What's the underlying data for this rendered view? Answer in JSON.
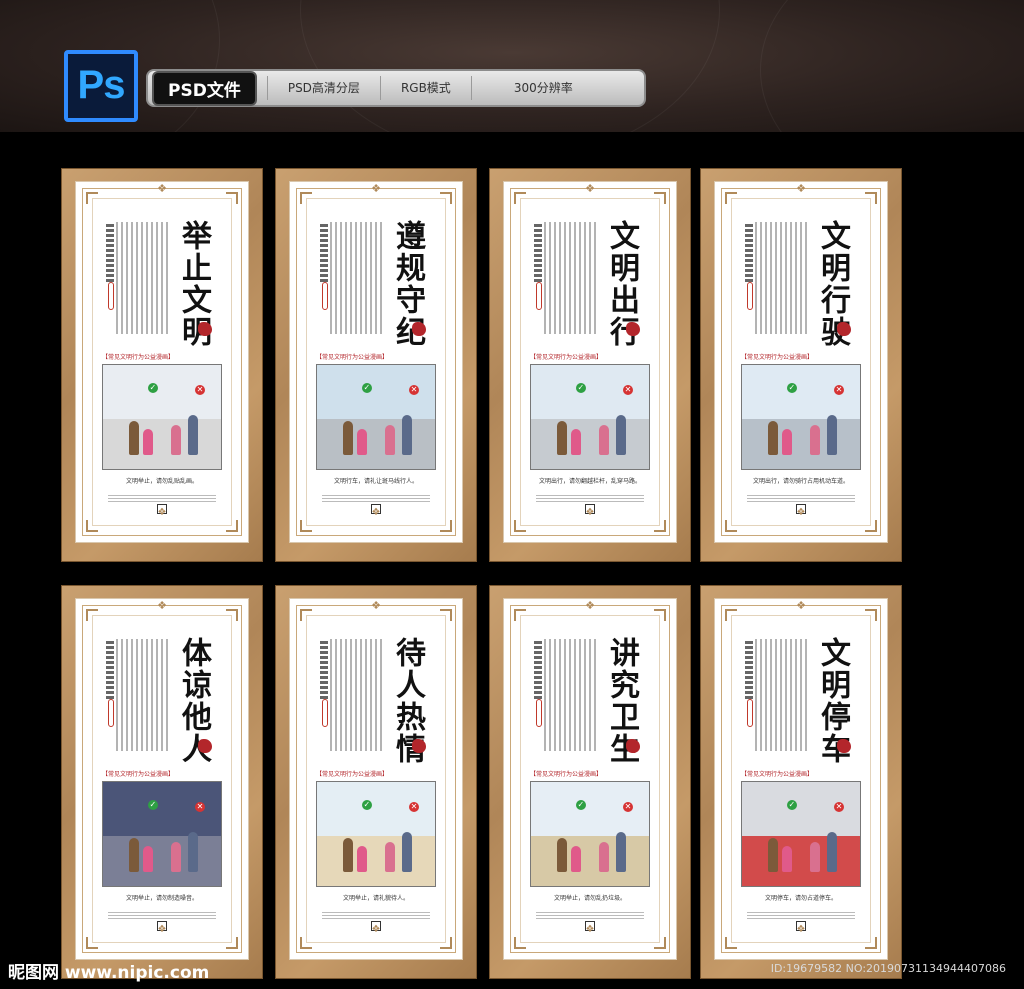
{
  "header": {
    "logo": "Ps",
    "toolbar": {
      "label": "PSD文件",
      "segments": [
        "PSD高清分层",
        "RGB模式",
        "300分辨率"
      ]
    }
  },
  "panels": [
    {
      "title": "举止文明",
      "caption": "文明举止，请勿乱贴乱画。",
      "sky": "#e9edf2",
      "ground": "#d8d8d8"
    },
    {
      "title": "遵规守纪",
      "caption": "文明行车，请礼让斑马线行人。",
      "sky": "#cfe0ec",
      "ground": "#b9bfc5"
    },
    {
      "title": "文明出行",
      "caption": "文明出行，请勿翻越栏杆，乱穿马路。",
      "sky": "#dfe9f2",
      "ground": "#c6cbd0"
    },
    {
      "title": "文明行驶",
      "caption": "文明出行，请勿骑行占用机动车道。",
      "sky": "#dfeaf3",
      "ground": "#b7c0c9"
    },
    {
      "title": "体谅他人",
      "caption": "文明举止，请勿制造噪音。",
      "sky": "#4b5578",
      "ground": "#7b7f96"
    },
    {
      "title": "待人热情",
      "caption": "文明举止，请礼貌待人。",
      "sky": "#e4eef4",
      "ground": "#e6d8b9"
    },
    {
      "title": "讲究卫生",
      "caption": "文明举止，请勿乱扔垃圾。",
      "sky": "#e6eef5",
      "ground": "#d7c9a6"
    },
    {
      "title": "文明停车",
      "caption": "文明停车，请勿占道停车。",
      "sky": "#d9dbe0",
      "ground": "#d24b4b"
    }
  ],
  "scene_label": "【常见文明行为公益漫画】",
  "watermark": {
    "left": "昵图网 www.nipic.com",
    "right": "ID:19679582 NO:20190731134944407086"
  },
  "colors": {
    "accent_red": "#b3262b",
    "frame_wood": "#c9a070",
    "ps_blue": "#31a8ff"
  }
}
